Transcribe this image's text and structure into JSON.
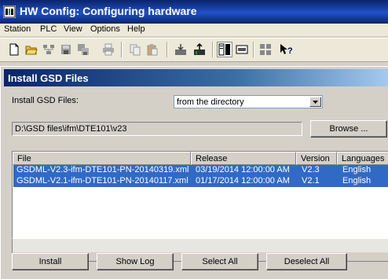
{
  "app": {
    "title": "HW Config: Configuring hardware"
  },
  "menu": [
    "Station",
    "PLC",
    "View",
    "Options",
    "Help"
  ],
  "toolbar": {
    "icons": [
      "new-icon",
      "open-icon",
      "network-icon",
      "save-icon",
      "save-compile-icon",
      "print-icon",
      "copy-icon",
      "paste-icon",
      "download-icon",
      "upload-icon",
      "catalog-icon",
      "module-icon",
      "hardware-icon",
      "help-pointer-icon"
    ]
  },
  "dialog": {
    "title": "Install GSD Files",
    "source_label": "Install GSD Files:",
    "source_value": "from the directory",
    "path_value": "D:\\GSD files\\ifm\\DTE101\\v23",
    "browse_label": "Browse ...",
    "columns": [
      "File",
      "Release",
      "Version",
      "Languages"
    ],
    "rows": [
      {
        "file": "GSDML-V2.3-ifm-DTE101-PN-20140319.xml",
        "release": "03/19/2014 12:00:00 AM",
        "version": "V2.3",
        "languages": "English"
      },
      {
        "file": "GSDML-V2.1-ifm-DTE101-PN-20140117.xml",
        "release": "01/17/2014 12:00:00 AM",
        "version": "V2.1",
        "languages": "English"
      }
    ],
    "buttons": {
      "install": "Install",
      "show_log": "Show Log",
      "select_all": "Select All",
      "deselect_all": "Deselect All"
    }
  },
  "colors": {
    "title_bar": "#0a246a",
    "selection": "#316ac5",
    "face": "#d4d0c8"
  }
}
